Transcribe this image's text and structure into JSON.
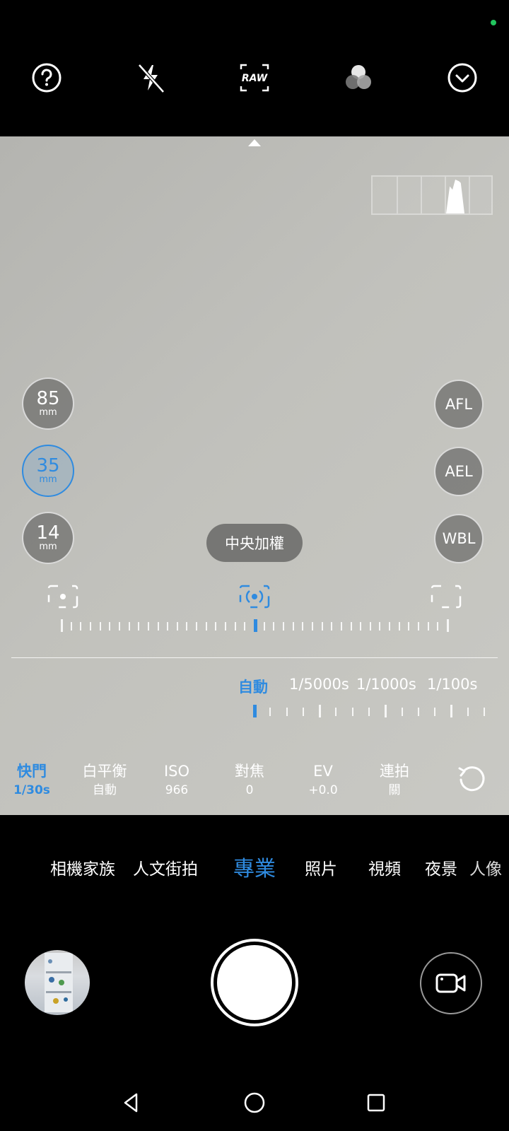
{
  "top_bar": {
    "icons": [
      "help-icon",
      "flash-off-icon",
      "raw-icon",
      "color-filter-icon",
      "more-chevron-icon"
    ],
    "raw_label": "RAW"
  },
  "focal_lengths": [
    {
      "value": "85",
      "unit": "mm",
      "active": false
    },
    {
      "value": "35",
      "unit": "mm",
      "active": true
    },
    {
      "value": "14",
      "unit": "mm",
      "active": false
    }
  ],
  "locks": [
    "AFL",
    "AEL",
    "WBL"
  ],
  "metering": {
    "label": "中央加權",
    "modes": [
      "spot-metering-icon",
      "center-weighted-metering-icon",
      "matrix-metering-icon"
    ],
    "selected": "center-weighted-metering-icon"
  },
  "shutter_speed": {
    "auto_label": "自動",
    "options": [
      "1/5000s",
      "1/1000s",
      "1/100s"
    ]
  },
  "params": [
    {
      "label": "快門",
      "value": "1/30s",
      "active": true
    },
    {
      "label": "白平衡",
      "value": "自動",
      "active": false
    },
    {
      "label": "ISO",
      "value": "966",
      "active": false
    },
    {
      "label": "對焦",
      "value": "0",
      "active": false
    },
    {
      "label": "EV",
      "value": "+0.0",
      "active": false
    },
    {
      "label": "連拍",
      "value": "關",
      "active": false
    }
  ],
  "modes": {
    "items": [
      "相機家族",
      "人文街拍",
      "專業",
      "照片",
      "視頻",
      "夜景",
      "人像"
    ],
    "active": "專業"
  },
  "colors": {
    "accent": "#2f8be0",
    "status_dot": "#22c55e"
  }
}
